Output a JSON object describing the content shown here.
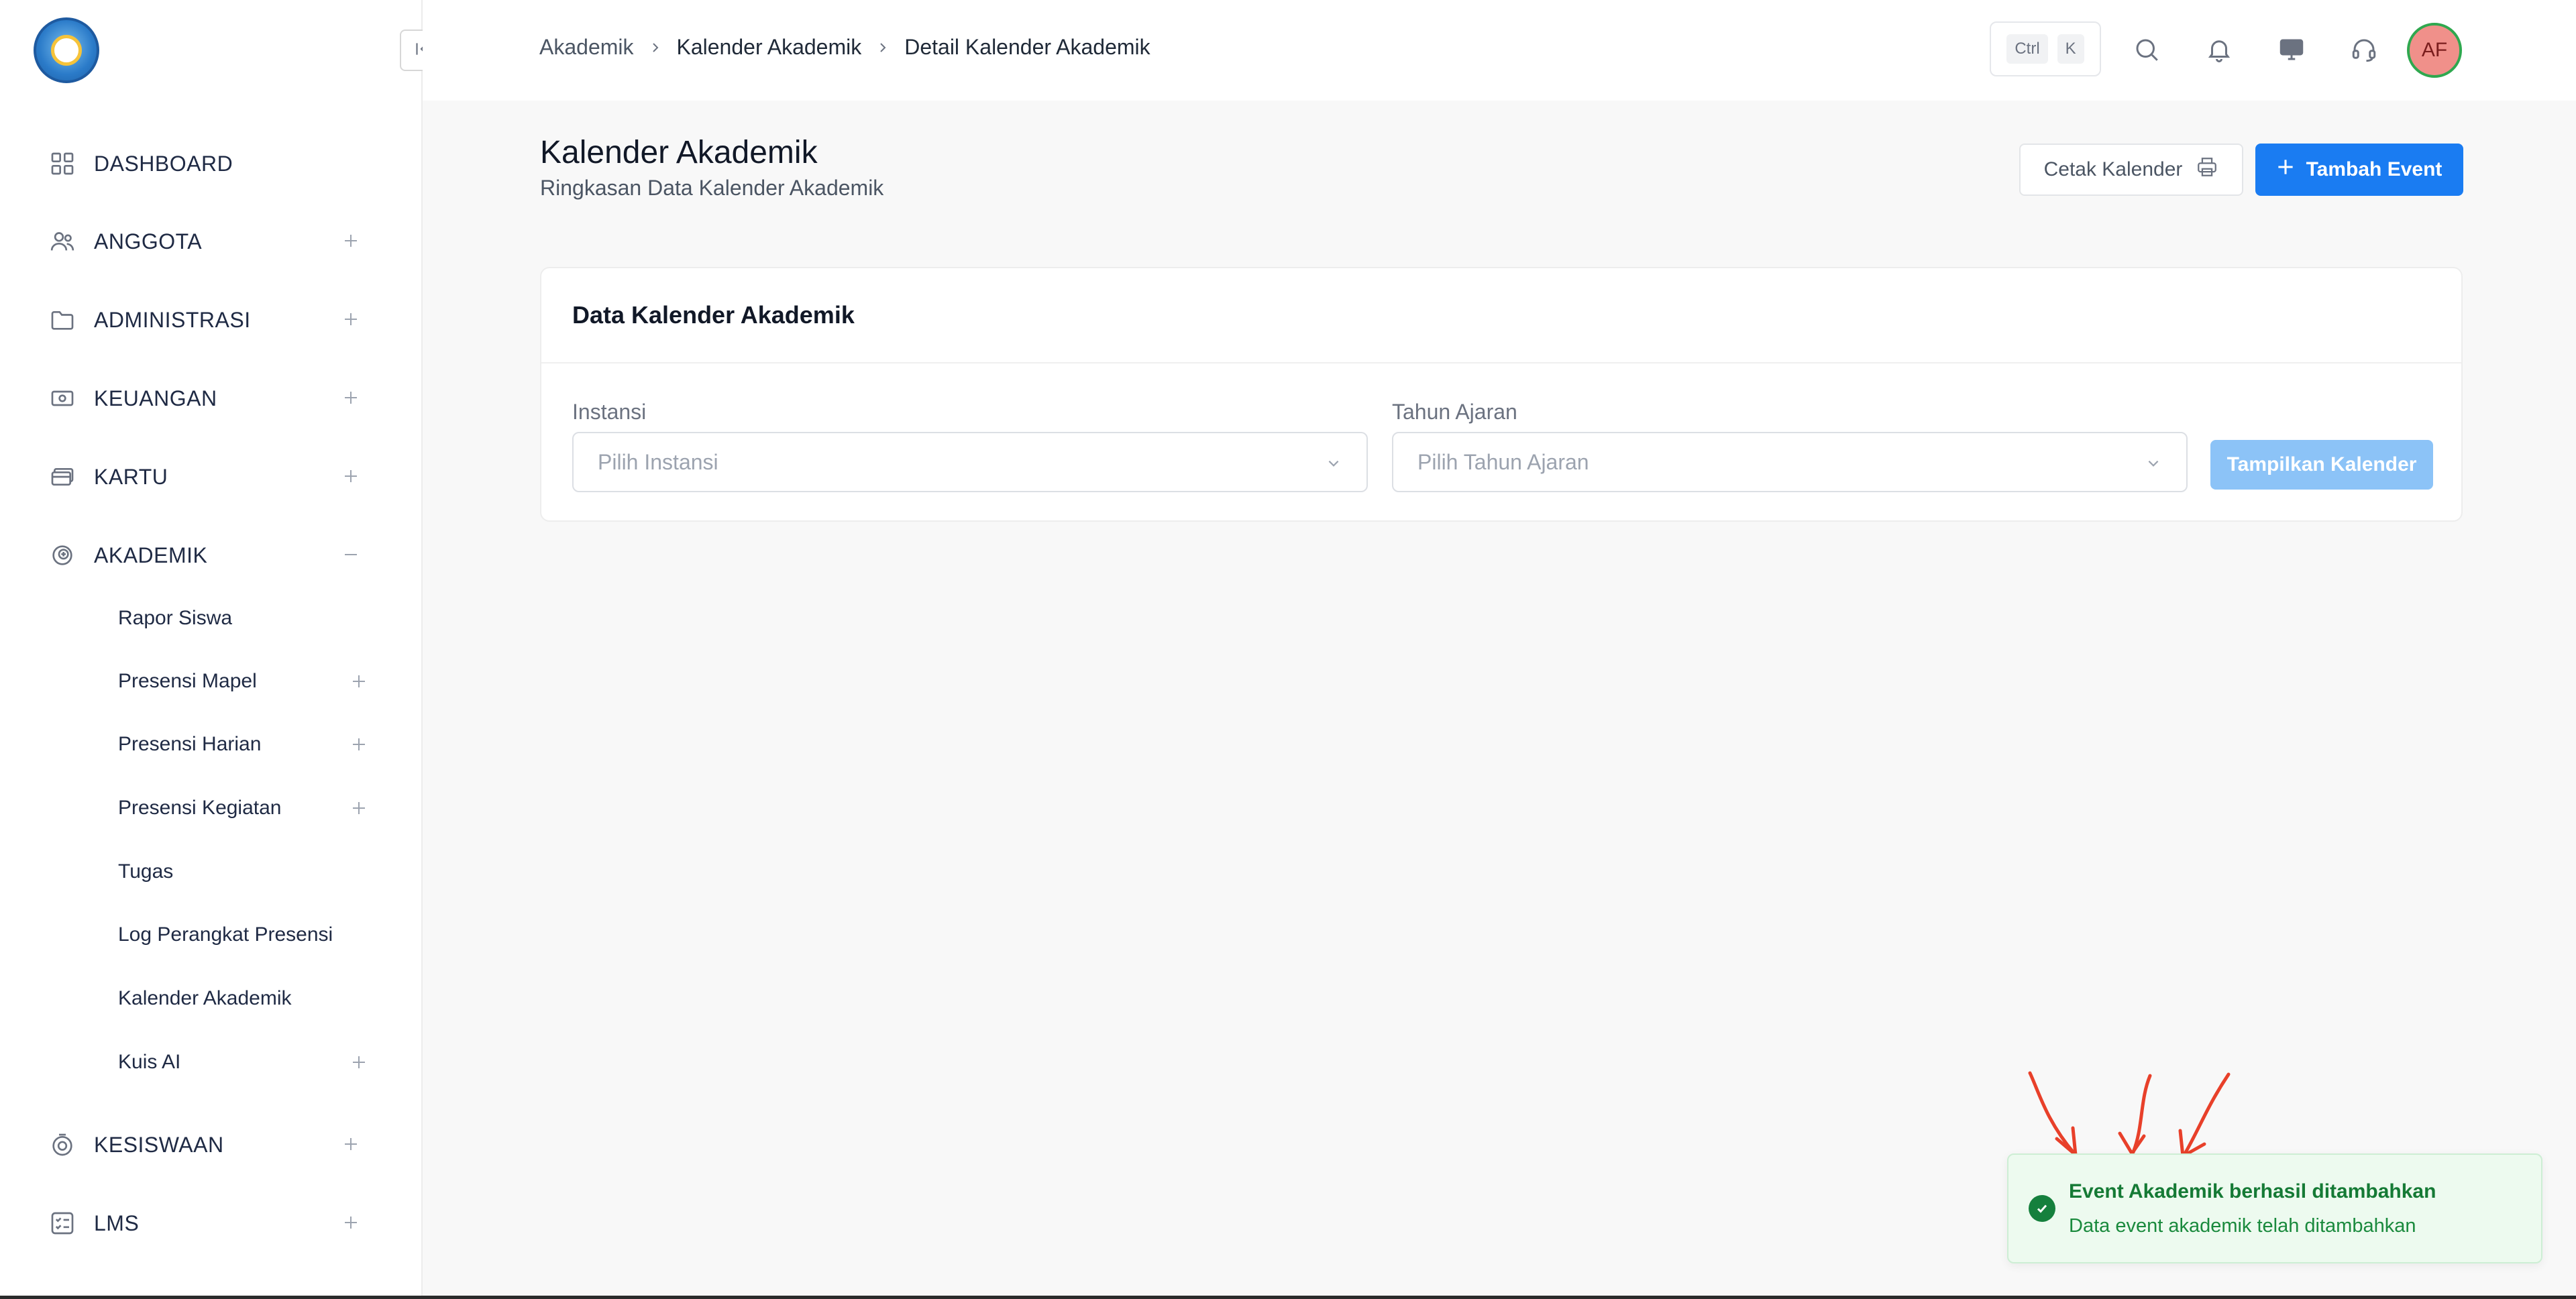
{
  "sidebar": {
    "items": [
      {
        "label": "DASHBOARD",
        "icon": "grid-icon"
      },
      {
        "label": "ANGGOTA",
        "icon": "users-icon"
      },
      {
        "label": "ADMINISTRASI",
        "icon": "folder-icon"
      },
      {
        "label": "KEUANGAN",
        "icon": "money-icon"
      },
      {
        "label": "KARTU",
        "icon": "card-icon"
      },
      {
        "label": "AKADEMIK",
        "icon": "academic-icon",
        "expanded": true
      },
      {
        "label": "KESISWAAN",
        "icon": "student-icon"
      },
      {
        "label": "LMS",
        "icon": "checklist-icon"
      }
    ],
    "akademik_sub": [
      {
        "label": "Rapor Siswa"
      },
      {
        "label": "Presensi Mapel"
      },
      {
        "label": "Presensi Harian"
      },
      {
        "label": "Presensi Kegiatan"
      },
      {
        "label": "Tugas"
      },
      {
        "label": "Log Perangkat Presensi"
      },
      {
        "label": "Kalender Akademik"
      },
      {
        "label": "Kuis AI"
      }
    ]
  },
  "header": {
    "breadcrumb": [
      "Akademik",
      "Kalender Akademik",
      "Detail Kalender Akademik"
    ],
    "shortcut": {
      "key1": "Ctrl",
      "key2": "K"
    },
    "avatar_initials": "AF"
  },
  "page": {
    "title": "Kalender Akademik",
    "subtitle": "Ringkasan Data Kalender Akademik",
    "print_button": "Cetak Kalender",
    "add_button": "Tambah Event"
  },
  "card": {
    "title": "Data Kalender Akademik",
    "instansi_label": "Instansi",
    "instansi_placeholder": "Pilih Instansi",
    "tahun_label": "Tahun Ajaran",
    "tahun_placeholder": "Pilih Tahun Ajaran",
    "show_button": "Tampilkan Kalender"
  },
  "toast": {
    "title": "Event Akademik berhasil ditambahkan",
    "description": "Data event akademik telah ditambahkan"
  },
  "colors": {
    "primary": "#1a7cf2",
    "primary_disabled": "#8cc3f7",
    "success": "#15803d",
    "success_bg": "#edfaef",
    "annotation_arrow": "#e8402a"
  }
}
